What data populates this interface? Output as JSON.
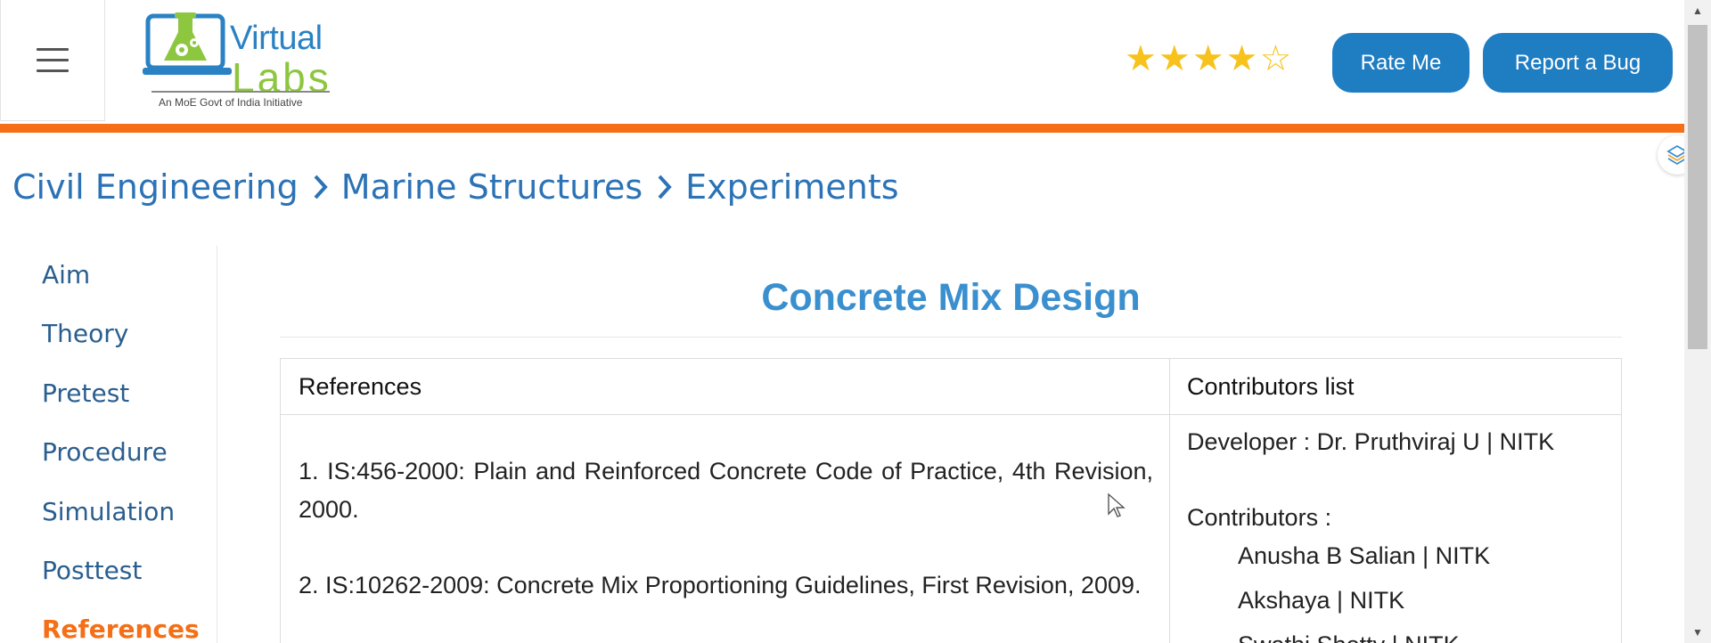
{
  "header": {
    "logo": {
      "line1": "Virtual",
      "line2": "Labs",
      "tagline": "An MoE Govt of India Initiative"
    },
    "rating": {
      "value": 4,
      "max": 5,
      "color": "#f7c21b"
    },
    "rate_button": "Rate Me",
    "bug_button": "Report a Bug",
    "accent_color": "#f46f16",
    "button_color": "#1f7dc2"
  },
  "breadcrumb": [
    "Civil Engineering",
    "Marine Structures",
    "Experiments"
  ],
  "sidebar": {
    "items": [
      {
        "label": "Aim"
      },
      {
        "label": "Theory"
      },
      {
        "label": "Pretest"
      },
      {
        "label": "Procedure"
      },
      {
        "label": "Simulation"
      },
      {
        "label": "Posttest"
      },
      {
        "label": "References",
        "active": true
      }
    ]
  },
  "main": {
    "title": "Concrete Mix Design",
    "table": {
      "headers": [
        "References",
        "Contributors list"
      ],
      "references": [
        "1. IS:456-2000: Plain and Reinforced Concrete Code of Practice, 4th Revision, 2000.",
        "2. IS:10262-2009: Concrete Mix Proportioning Guidelines, First Revision, 2009."
      ],
      "developer": "Developer : Dr. Pruthviraj U | NITK",
      "contributors_label": "Contributors :",
      "contributors": [
        "Anusha B Salian | NITK",
        "Akshaya | NITK",
        "Swathi Shetty | NITK"
      ]
    }
  }
}
